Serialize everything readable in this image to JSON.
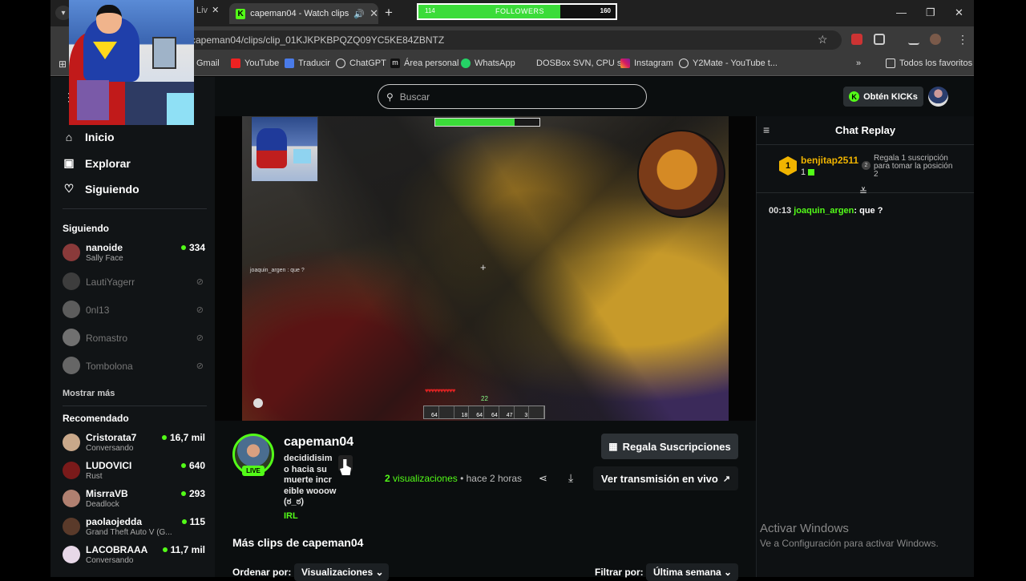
{
  "browser": {
    "prev_tab_fragment": "Liv",
    "active_tab_title": "capeman04 - Watch clips o",
    "url": "capeman04/clips/clip_01KJKPKBPQZQ09YC5KE84ZBNTZ",
    "bookmarks": [
      "Gmail",
      "YouTube",
      "Traducir",
      "ChatGPT",
      "Área personal",
      "WhatsApp",
      "DOSBox SVN, CPU s...",
      "Instagram",
      "Y2Mate - YouTube t..."
    ],
    "all_bookmarks": "Todos los favoritos",
    "overflow": "»"
  },
  "followers_goal": {
    "current": "114",
    "label": "FOLLOWERS",
    "goal": "160",
    "fill_fraction": 0.72
  },
  "search": {
    "placeholder": "Buscar"
  },
  "kicks_button": "Obtén KICKs",
  "nav": {
    "home": "Inicio",
    "explore": "Explorar",
    "following": "Siguiendo"
  },
  "sidebar": {
    "following_heading": "Siguiendo",
    "following": [
      {
        "name": "nanoide",
        "sub": "Sally Face",
        "viewers": "334",
        "live": true
      },
      {
        "name": "LautiYagerr",
        "live": false
      },
      {
        "name": "0nl13",
        "live": false
      },
      {
        "name": "Romastro",
        "live": false
      },
      {
        "name": "Tombolona",
        "live": false
      }
    ],
    "show_more": "Mostrar más",
    "recommended_heading": "Recomendado",
    "recommended": [
      {
        "name": "Cristorata7",
        "sub": "Conversando",
        "viewers": "16,7 mil"
      },
      {
        "name": "LUDOVICI",
        "sub": "Rust",
        "viewers": "640"
      },
      {
        "name": "MisrraVB",
        "sub": "Deadlock",
        "viewers": "293"
      },
      {
        "name": "paolaojedda",
        "sub": "Grand Theft Auto V (G...",
        "viewers": "115"
      },
      {
        "name": "LACOBRAAA",
        "sub": "Conversando",
        "viewers": "11,7 mil"
      }
    ]
  },
  "video": {
    "game_chat": "joaquin_argen : que ?",
    "hud_numbers": [
      "64",
      "18",
      "64",
      "64",
      "47",
      "3"
    ],
    "xp_level": "22"
  },
  "clip": {
    "streamer": "capeman04",
    "live_badge": "LIVE",
    "title": "decididisimo hacia su muerte increible wooow (ಠ_ಠ)",
    "category": "IRL",
    "views_num": "2",
    "views_label": "visualizaciones",
    "time_ago": "• hace 2 horas",
    "gift_button": "Regala Suscripciones",
    "live_button": "Ver transmisión en vivo",
    "more_clips": "Más clips de capeman04",
    "order_label": "Ordenar por:",
    "order_value": "Visualizaciones",
    "filter_label": "Filtrar por:",
    "filter_value": "Última semana"
  },
  "chat": {
    "title": "Chat Replay",
    "gifter_rank": "1",
    "gifter_name": "benjitap2511",
    "gifter_count": "1",
    "promo_num": "2",
    "promo_text": "Regala 1 suscripción para tomar la posición 2",
    "messages": [
      {
        "time": "00:13",
        "user": "joaquin_argen",
        "text": ": que ?"
      }
    ]
  },
  "windows_watermark": {
    "title": "Activar Windows",
    "sub": "Ve a Configuración para activar Windows."
  },
  "colors": {
    "kick_green": "#53fc18",
    "gold": "#f0b400",
    "background": "#0b0e0f"
  }
}
